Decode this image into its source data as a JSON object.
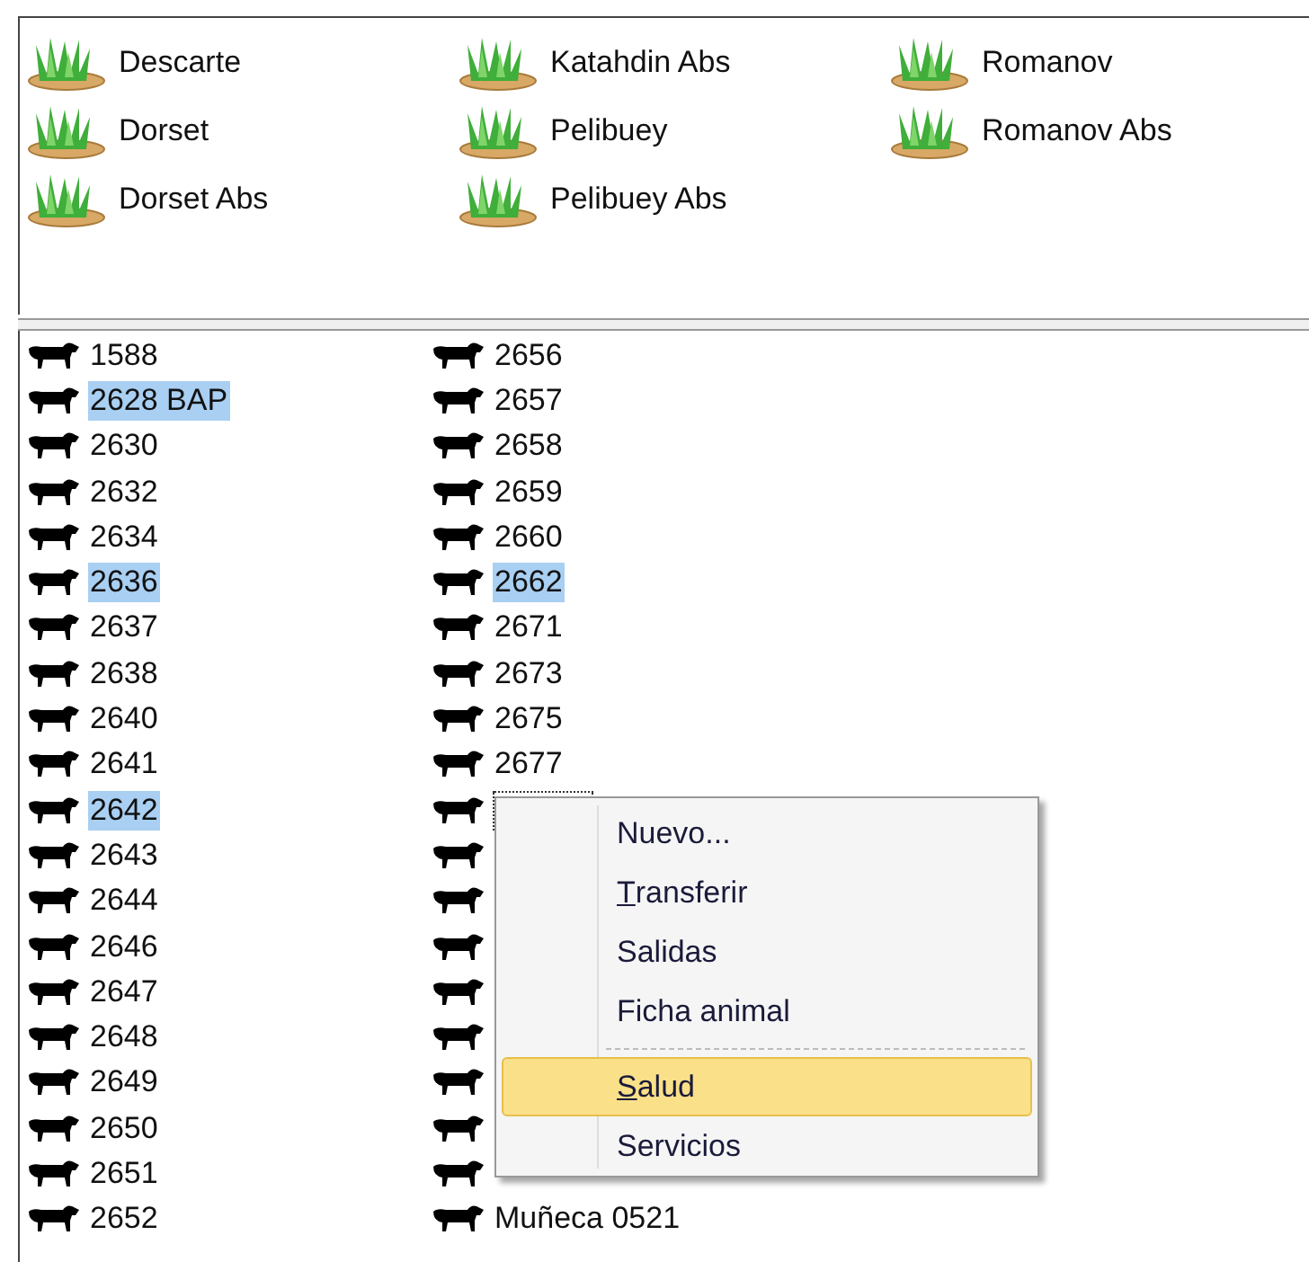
{
  "groups": [
    {
      "label": "Descarte"
    },
    {
      "label": "Dorset"
    },
    {
      "label": "Dorset Abs"
    },
    {
      "label": "Katahdin Abs"
    },
    {
      "label": "Pelibuey"
    },
    {
      "label": "Pelibuey Abs"
    },
    {
      "label": "Romanov"
    },
    {
      "label": "Romanov Abs"
    }
  ],
  "animals": {
    "column_1": [
      {
        "label": "1588",
        "selected": false
      },
      {
        "label": "2628 BAP",
        "selected": true
      },
      {
        "label": "2630",
        "selected": false
      },
      {
        "label": "2632",
        "selected": false
      },
      {
        "label": "2634",
        "selected": false
      },
      {
        "label": "2636",
        "selected": true
      },
      {
        "label": "2637",
        "selected": false
      },
      {
        "label": "2638",
        "selected": false
      },
      {
        "label": "2640",
        "selected": false
      },
      {
        "label": "2641",
        "selected": false
      },
      {
        "label": "2642",
        "selected": true
      },
      {
        "label": "2643",
        "selected": false
      },
      {
        "label": "2644",
        "selected": false
      },
      {
        "label": "2646",
        "selected": false
      },
      {
        "label": "2647",
        "selected": false
      },
      {
        "label": "2648",
        "selected": false
      },
      {
        "label": "2649",
        "selected": false
      },
      {
        "label": "2650",
        "selected": false
      },
      {
        "label": "2651",
        "selected": false
      },
      {
        "label": "2652",
        "selected": false
      }
    ],
    "column_2": [
      {
        "label": "2656",
        "selected": false
      },
      {
        "label": "2657",
        "selected": false
      },
      {
        "label": "2658",
        "selected": false
      },
      {
        "label": "2659",
        "selected": false
      },
      {
        "label": "2660",
        "selected": false
      },
      {
        "label": "2662",
        "selected": true
      },
      {
        "label": "2671",
        "selected": false
      },
      {
        "label": "2673",
        "selected": false
      },
      {
        "label": "2675",
        "selected": false
      },
      {
        "label": "2677",
        "selected": false
      },
      {
        "kind": "covered",
        "focused": true
      },
      {
        "kind": "covered"
      },
      {
        "kind": "covered"
      },
      {
        "kind": "covered"
      },
      {
        "kind": "covered"
      },
      {
        "kind": "covered"
      },
      {
        "kind": "covered"
      },
      {
        "kind": "covered"
      },
      {
        "kind": "covered"
      },
      {
        "label": "Muñeca 0521",
        "selected": false
      }
    ]
  },
  "context_menu": [
    {
      "kind": "item",
      "label": "Nuevo...",
      "mnemonic": false,
      "selected": false
    },
    {
      "kind": "item",
      "label": "Transferir",
      "mnemonic": true,
      "selected": false
    },
    {
      "kind": "item",
      "label": "Salidas",
      "mnemonic": false,
      "selected": false
    },
    {
      "kind": "item",
      "label": "Ficha animal",
      "mnemonic": false,
      "selected": false
    },
    {
      "kind": "separator"
    },
    {
      "kind": "item",
      "label": "Salud",
      "mnemonic": true,
      "selected": true
    },
    {
      "kind": "item",
      "label": "Servicios",
      "mnemonic": false,
      "selected": false
    }
  ]
}
